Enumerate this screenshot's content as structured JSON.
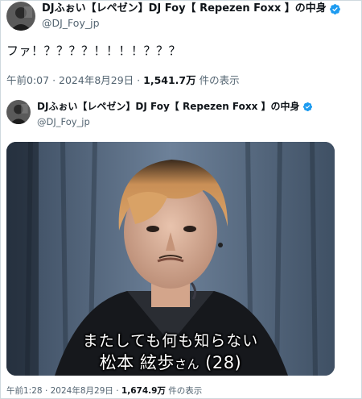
{
  "tweet": {
    "author": {
      "display_name": "DJふぉい【レペゼン】DJ Foy【 Repezen Foxx 】の中身",
      "handle": "@DJ_Foy_jp",
      "verified": true
    },
    "text": "ファ！？？？？！！！！？？？",
    "time": "午前0:07",
    "date": "2024年8月29日",
    "views_count": "1,541.7万",
    "views_label": "件の表示"
  },
  "quoted_tweet": {
    "author": {
      "display_name": "DJふぉい【レペゼン】DJ Foy【 Repezen Foxx 】の中身",
      "handle": "@DJ_Foy_jp",
      "verified": true
    },
    "media": {
      "caption_line1": "またしても何も知らない",
      "caption_name": "松本 絃歩",
      "caption_honorific": "さん",
      "caption_age": "(28)"
    },
    "time": "午前1:28",
    "date": "2024年8月29日",
    "views_count": "1,674.9万",
    "views_label": "件の表示"
  },
  "colors": {
    "verified_blue": "#1d9bf0",
    "secondary_text": "#536471",
    "primary_text": "#0f1419"
  },
  "icons": [
    "verified-badge-icon",
    "avatar"
  ]
}
